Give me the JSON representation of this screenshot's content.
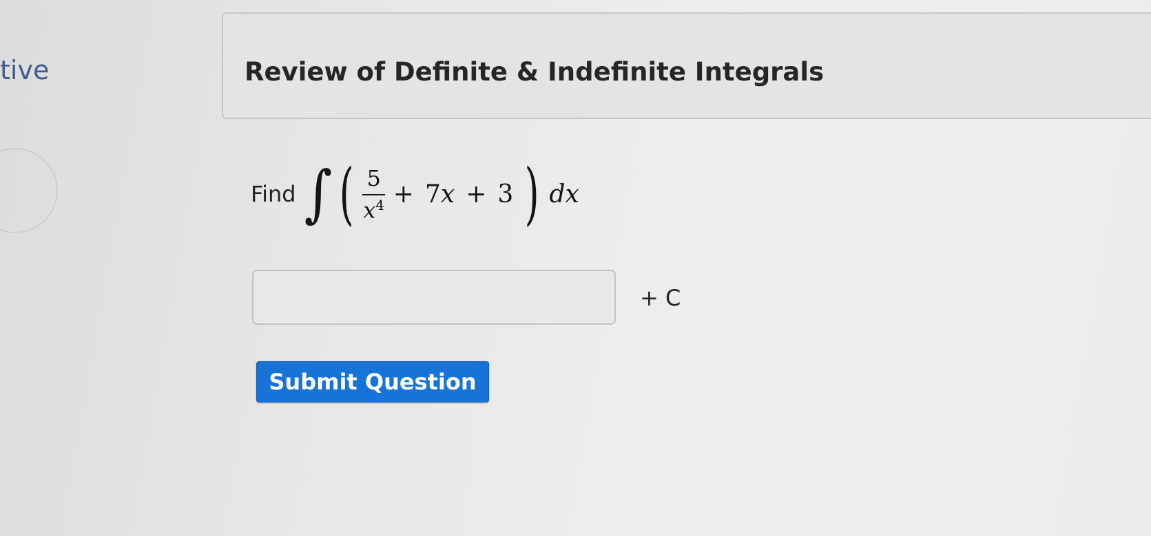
{
  "sidebar": {
    "fragment_text": "tive"
  },
  "header": {
    "title": "Review of Definite & Indefinite Integrals"
  },
  "question": {
    "prefix": "Find",
    "integral_sign": "∫",
    "open_paren": "(",
    "numerator": "5",
    "denominator_base": "x",
    "denominator_exp": "4",
    "plus_1": "+",
    "term_coef": "7",
    "term_var": "x",
    "plus_2": "+",
    "constant": "3",
    "close_paren": ")",
    "differential": "dx"
  },
  "answer": {
    "value": "",
    "placeholder": "",
    "suffix": "+ C"
  },
  "submit": {
    "label": "Submit Question"
  },
  "colors": {
    "submit_bg": "#1773d8",
    "sidebar_text": "#3f5d8c"
  }
}
